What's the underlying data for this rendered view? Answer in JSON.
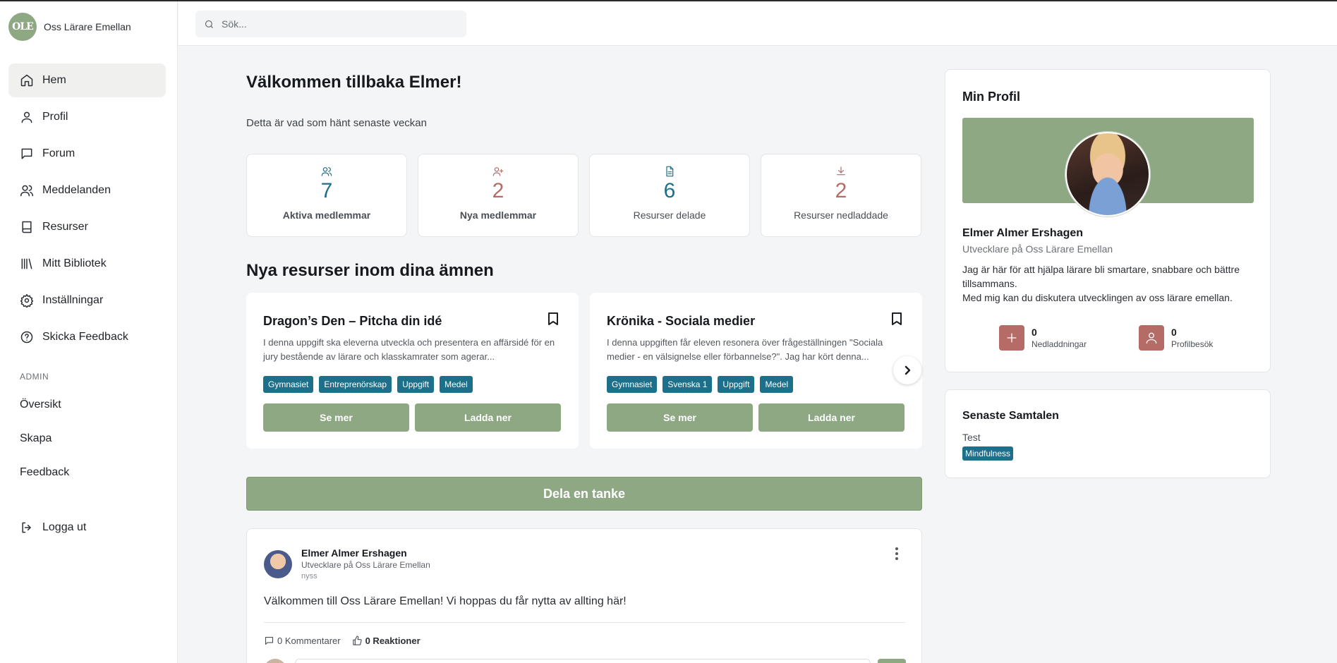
{
  "brand": {
    "logo_text": "OLE",
    "name": "Oss Lärare Emellan"
  },
  "search": {
    "placeholder": "Sök..."
  },
  "nav": [
    {
      "label": "Hem",
      "icon": "home-icon"
    },
    {
      "label": "Profil",
      "icon": "user-icon"
    },
    {
      "label": "Forum",
      "icon": "chat-icon"
    },
    {
      "label": "Meddelanden",
      "icon": "users-icon"
    },
    {
      "label": "Resurser",
      "icon": "book-icon"
    },
    {
      "label": "Mitt Bibliotek",
      "icon": "library-icon"
    },
    {
      "label": "Inställningar",
      "icon": "gear-icon"
    },
    {
      "label": "Skicka Feedback",
      "icon": "help-icon"
    }
  ],
  "admin": {
    "title": "ADMIN",
    "items": [
      "Översikt",
      "Skapa",
      "Feedback"
    ]
  },
  "logout": "Logga ut",
  "main": {
    "welcome": "Välkommen tillbaka Elmer!",
    "subtitle": "Detta är vad som hänt senaste veckan",
    "stats": [
      {
        "value": "7",
        "label": "Aktiva medlemmar",
        "color": "#1d6f8a",
        "icon": "users-icon"
      },
      {
        "value": "2",
        "label": "Nya medlemmar",
        "color": "#b56c66",
        "icon": "user-plus-icon"
      },
      {
        "value": "6",
        "label": "Resurser delade",
        "color": "#1d6f8a",
        "icon": "document-icon"
      },
      {
        "value": "2",
        "label": "Resurser nedladdade",
        "color": "#b56c66",
        "icon": "download-icon"
      }
    ],
    "resources_title": "Nya resurser inom dina ämnen",
    "resources": [
      {
        "title": "Dragon’s Den – Pitcha din idé",
        "description": "I denna uppgift ska eleverna utveckla och presentera en affärsidé för en jury bestående av lärare och klasskamrater som agerar...",
        "tags": [
          "Gymnasiet",
          "Entreprenörskap",
          "Uppgift",
          "Medel"
        ],
        "btn_more": "Se mer",
        "btn_download": "Ladda ner"
      },
      {
        "title": "Krönika - Sociala medier",
        "description": "I denna uppgiften får eleven resonera över frågeställningen \"Sociala medier - en välsignelse eller förbannelse?\". Jag har kört denna...",
        "tags": [
          "Gymnasiet",
          "Svenska 1",
          "Uppgift",
          "Medel"
        ],
        "btn_more": "Se mer",
        "btn_download": "Ladda ner"
      }
    ],
    "share_button": "Dela en tanke",
    "post": {
      "author": "Elmer Almer Ershagen",
      "role": "Utvecklare på Oss Lärare Emellan",
      "time": "nyss",
      "text": "Välkommen till Oss Lärare Emellan! Vi hoppas du får nytta av allting här!",
      "comments": "0 Kommentarer",
      "reactions": "0 Reaktioner"
    }
  },
  "profile": {
    "title": "Min Profil",
    "name": "Elmer Almer Ershagen",
    "role": "Utvecklare på Oss Lärare Emellan",
    "bio_line1": "Jag är här för att hjälpa lärare bli smartare, snabbare och bättre tillsammans.",
    "bio_line2": "Med mig kan du diskutera utvecklingen av oss lärare emellan.",
    "downloads_value": "0",
    "downloads_label": "Nedladdningar",
    "visits_value": "0",
    "visits_label": "Profilbesök"
  },
  "conversations": {
    "title": "Senaste Samtalen",
    "item": "Test",
    "tag": "Mindfulness"
  },
  "colors": {
    "accent_green": "#8ea884",
    "teal": "#1d6f8a",
    "rose": "#b56c66"
  }
}
